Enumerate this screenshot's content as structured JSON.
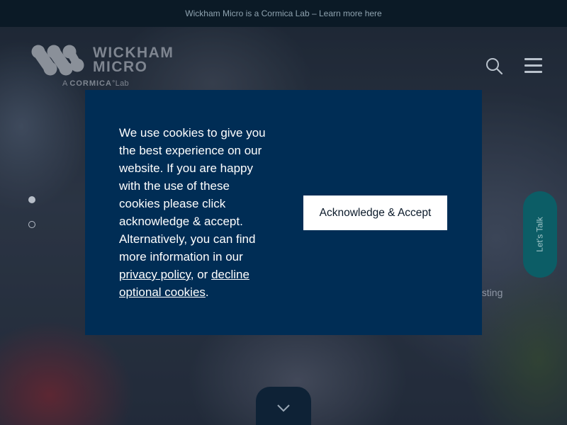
{
  "announcement": {
    "text": "Wickham Micro is a Cormica Lab – Learn more here"
  },
  "logo": {
    "line1": "WICKHAM",
    "line2": "MICRO",
    "sub_prefix": "A",
    "sub_brand": "CORMICA",
    "sub_suffix": "°Lab"
  },
  "header": {
    "search_icon": "search-icon",
    "menu_icon": "hamburger-menu-icon"
  },
  "slider": {
    "dots": 2,
    "active_index": 0
  },
  "hero": {
    "fragment": "esting"
  },
  "lets_talk": {
    "label": "Let's Talk"
  },
  "cookie_modal": {
    "text_main": "We use cookies to give you the best experience on our website. If you are happy with the use of these cookies please click acknowledge & accept. Alternatively, you can find more information in our ",
    "privacy_link": "privacy policy",
    "text_or": ", or ",
    "decline_link": "decline optional cookies",
    "text_end": ".",
    "accept_button": "Acknowledge & Accept"
  },
  "colors": {
    "modal_bg": "#002d55",
    "topbar_bg": "#0b1a26",
    "lets_talk_bg": "#0c5d66",
    "accept_button_bg": "#ffffff"
  }
}
